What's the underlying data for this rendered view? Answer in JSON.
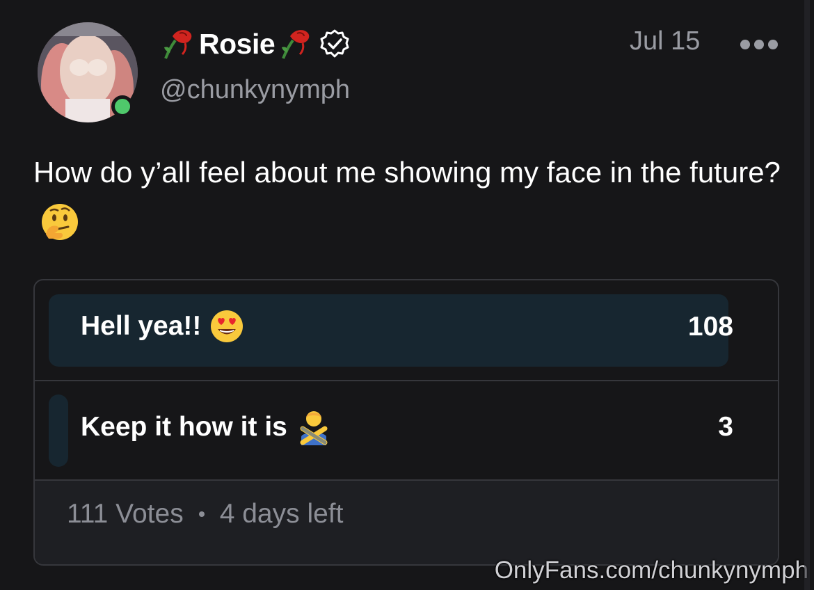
{
  "author": {
    "display_name": "Rosie",
    "handle": "@chunkynymph",
    "online": true,
    "verified": true
  },
  "post": {
    "date": "Jul 15",
    "caption": "How do y’all feel about me showing my face in the future?"
  },
  "poll": {
    "options": [
      {
        "label": "Hell yea!!",
        "emoji": "heart-eyes-face",
        "votes": "108",
        "share": 0.973
      },
      {
        "label": "Keep it how it is",
        "emoji": "person-gesturing-no",
        "votes": "3",
        "share": 0.027
      }
    ],
    "total_votes": "111 Votes",
    "time_left": "4 days left"
  },
  "watermark": "OnlyFans.com/chunkynymph",
  "icons": {
    "more": "ellipsis-icon",
    "verified": "verified-badge-icon",
    "rose": "wilted-rose-icon",
    "thinking": "thinking-face-emoji"
  },
  "colors": {
    "background": "#161618",
    "poll_fill": "#172630",
    "online": "#4fc96b",
    "muted_text": "#9a9ca3"
  }
}
